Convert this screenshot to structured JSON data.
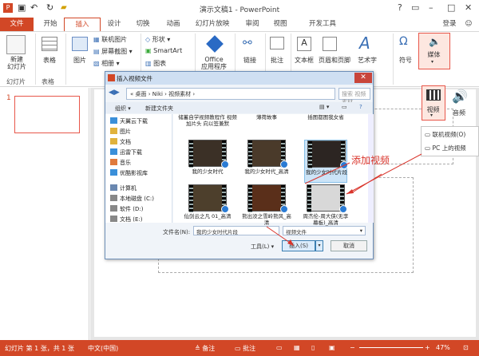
{
  "window": {
    "title": "演示文稿1 - PowerPoint",
    "user": "登录"
  },
  "tabs": [
    "文件",
    "开始",
    "插入",
    "设计",
    "切换",
    "动画",
    "幻灯片放映",
    "审阅",
    "视图",
    "开发工具"
  ],
  "ribbon": {
    "new_slide": "新建\n幻灯片",
    "table": "表格",
    "image": "图片",
    "online_pictures": "联机图片",
    "screenshot": "屏幕截图",
    "album": "相册",
    "shapes": "形状",
    "smartart": "SmartArt",
    "chart": "图表",
    "office_apps": "Office\n应用程序",
    "link": "链接",
    "comment": "批注",
    "textbox": "文本框",
    "header_footer": "页眉和页脚",
    "wordart": "艺术字",
    "symbol": "符号",
    "media": "媒体",
    "video": "视频",
    "audio": "音频",
    "group_slides": "幻灯片",
    "group_tables": "表格"
  },
  "dropdown": {
    "online_video": "联机视频(O)",
    "pc_video": "PC 上的视频"
  },
  "slide_number": "1",
  "dialog": {
    "title": "插入视频文件",
    "address": "« 桌面 › Niki › 视频素材 ›",
    "search": "搜索 视频素材",
    "organize": "组织 ▾",
    "new_folder": "新建文件夹",
    "nav": [
      "天翼云下载",
      "图片",
      "文档",
      "迅雷下载",
      "音乐",
      "优酷影视库",
      "计算机",
      "本地磁盘 (C:)",
      "软件 (D:)",
      "文档 (E:)"
    ],
    "top_files": [
      "储蓄自学视频教程作 视频加片头 向以签兼默",
      "薄荷故事",
      "插图都图我女省"
    ],
    "files": [
      "我的少女时代",
      "我的少女时代_高清",
      "我的少女时代片段",
      "仙剑云之凡 01_高清",
      "熊出没之雪岭熊风_高清",
      "周杰伦-周大侠(无李幕板)_高清"
    ],
    "filename_label": "文件名(N):",
    "filename": "我的少女时代片段",
    "filetype": "视频文件",
    "tools": "工具(L)  ▾",
    "insert": "插入(S)",
    "cancel": "取消"
  },
  "annotation": "添加视频",
  "status": {
    "slide_info": "幻灯片 第 1 张，共 1 张",
    "language": "中文(中国)",
    "notes": "备注",
    "comments": "批注",
    "zoom": "47%"
  },
  "colors": {
    "accent": "#d24726",
    "highlight": "#e8574a"
  }
}
